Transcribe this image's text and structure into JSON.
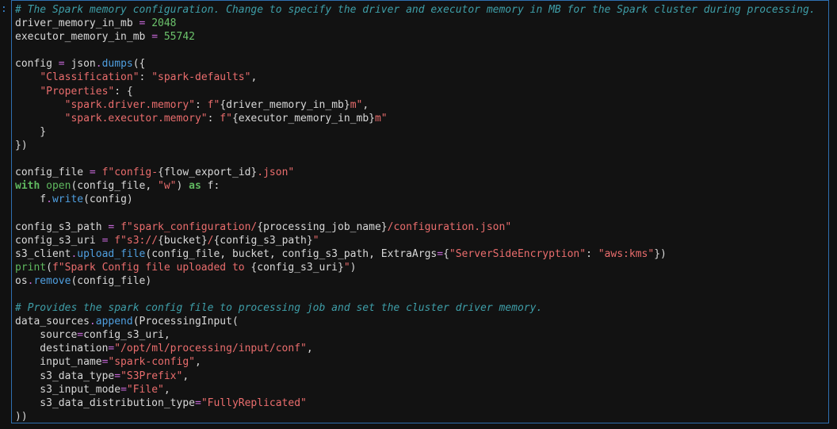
{
  "gutter": {
    "marker": ":"
  },
  "colors": {
    "background": "#121212",
    "cell_border": "#2f6fb0",
    "comment": "#3e9ea8",
    "string": "#ea6d6d",
    "number": "#6cc36c",
    "operator": "#c768d8",
    "keyword": "#5fb85f",
    "function": "#4f9fe0",
    "default": "#d8d8d8"
  },
  "code_lines": [
    [
      [
        "comment",
        "# The Spark memory configuration. Change to specify the driver and executor memory in MB for the Spark cluster during processing."
      ]
    ],
    [
      [
        "id",
        "driver_memory_in_mb "
      ],
      [
        "op",
        "="
      ],
      [
        "p",
        " "
      ],
      [
        "num",
        "2048"
      ]
    ],
    [
      [
        "id",
        "executor_memory_in_mb "
      ],
      [
        "op",
        "="
      ],
      [
        "p",
        " "
      ],
      [
        "num",
        "55742"
      ]
    ],
    [],
    [
      [
        "id",
        "config "
      ],
      [
        "op",
        "="
      ],
      [
        "p",
        " json"
      ],
      [
        "op",
        "."
      ],
      [
        "fn",
        "dumps"
      ],
      [
        "p",
        "({"
      ]
    ],
    [
      [
        "p",
        "    "
      ],
      [
        "str",
        "\"Classification\""
      ],
      [
        "p",
        ": "
      ],
      [
        "str",
        "\"spark-defaults\""
      ],
      [
        "p",
        ","
      ]
    ],
    [
      [
        "p",
        "    "
      ],
      [
        "str",
        "\"Properties\""
      ],
      [
        "p",
        ": {"
      ]
    ],
    [
      [
        "p",
        "        "
      ],
      [
        "str",
        "\"spark.driver.memory\""
      ],
      [
        "p",
        ": "
      ],
      [
        "str",
        "f\""
      ],
      [
        "p",
        "{driver_memory_in_mb}"
      ],
      [
        "str",
        "m\""
      ],
      [
        "p",
        ","
      ]
    ],
    [
      [
        "p",
        "        "
      ],
      [
        "str",
        "\"spark.executor.memory\""
      ],
      [
        "p",
        ": "
      ],
      [
        "str",
        "f\""
      ],
      [
        "p",
        "{executor_memory_in_mb}"
      ],
      [
        "str",
        "m\""
      ]
    ],
    [
      [
        "p",
        "    }"
      ]
    ],
    [
      [
        "p",
        "})"
      ]
    ],
    [],
    [
      [
        "id",
        "config_file "
      ],
      [
        "op",
        "="
      ],
      [
        "p",
        " "
      ],
      [
        "str",
        "f\"config-"
      ],
      [
        "p",
        "{flow_export_id}"
      ],
      [
        "str",
        ".json\""
      ]
    ],
    [
      [
        "kw",
        "with"
      ],
      [
        "p",
        " "
      ],
      [
        "bi",
        "open"
      ],
      [
        "p",
        "(config_file, "
      ],
      [
        "str",
        "\"w\""
      ],
      [
        "p",
        ") "
      ],
      [
        "kw",
        "as"
      ],
      [
        "p",
        " f:"
      ]
    ],
    [
      [
        "p",
        "    f"
      ],
      [
        "op",
        "."
      ],
      [
        "fn",
        "write"
      ],
      [
        "p",
        "(config)"
      ]
    ],
    [],
    [
      [
        "id",
        "config_s3_path "
      ],
      [
        "op",
        "="
      ],
      [
        "p",
        " "
      ],
      [
        "str",
        "f\"spark_configuration/"
      ],
      [
        "p",
        "{processing_job_name}"
      ],
      [
        "str",
        "/configuration.json\""
      ]
    ],
    [
      [
        "id",
        "config_s3_uri "
      ],
      [
        "op",
        "="
      ],
      [
        "p",
        " "
      ],
      [
        "str",
        "f\"s3://"
      ],
      [
        "p",
        "{bucket}"
      ],
      [
        "str",
        "/"
      ],
      [
        "p",
        "{config_s3_path}"
      ],
      [
        "str",
        "\""
      ]
    ],
    [
      [
        "id",
        "s3_client"
      ],
      [
        "op",
        "."
      ],
      [
        "fn",
        "upload_file"
      ],
      [
        "p",
        "(config_file, bucket, config_s3_path, ExtraArgs"
      ],
      [
        "op",
        "="
      ],
      [
        "p",
        "{"
      ],
      [
        "str",
        "\"ServerSideEncryption\""
      ],
      [
        "p",
        ": "
      ],
      [
        "str",
        "\"aws:kms\""
      ],
      [
        "p",
        "})"
      ]
    ],
    [
      [
        "bi",
        "print"
      ],
      [
        "p",
        "("
      ],
      [
        "str",
        "f\"Spark Config file uploaded to "
      ],
      [
        "p",
        "{config_s3_uri}"
      ],
      [
        "str",
        "\""
      ],
      [
        "p",
        ")"
      ]
    ],
    [
      [
        "id",
        "os"
      ],
      [
        "op",
        "."
      ],
      [
        "fn",
        "remove"
      ],
      [
        "p",
        "(config_file)"
      ]
    ],
    [],
    [
      [
        "comment",
        "# Provides the spark config file to processing job and set the cluster driver memory."
      ]
    ],
    [
      [
        "id",
        "data_sources"
      ],
      [
        "op",
        "."
      ],
      [
        "fn",
        "append"
      ],
      [
        "p",
        "(ProcessingInput("
      ]
    ],
    [
      [
        "p",
        "    source"
      ],
      [
        "op",
        "="
      ],
      [
        "p",
        "config_s3_uri,"
      ]
    ],
    [
      [
        "p",
        "    destination"
      ],
      [
        "op",
        "="
      ],
      [
        "str",
        "\"/opt/ml/processing/input/conf\""
      ],
      [
        "p",
        ","
      ]
    ],
    [
      [
        "p",
        "    input_name"
      ],
      [
        "op",
        "="
      ],
      [
        "str",
        "\"spark-config\""
      ],
      [
        "p",
        ","
      ]
    ],
    [
      [
        "p",
        "    s3_data_type"
      ],
      [
        "op",
        "="
      ],
      [
        "str",
        "\"S3Prefix\""
      ],
      [
        "p",
        ","
      ]
    ],
    [
      [
        "p",
        "    s3_input_mode"
      ],
      [
        "op",
        "="
      ],
      [
        "str",
        "\"File\""
      ],
      [
        "p",
        ","
      ]
    ],
    [
      [
        "p",
        "    s3_data_distribution_type"
      ],
      [
        "op",
        "="
      ],
      [
        "str",
        "\"FullyReplicated\""
      ]
    ],
    [
      [
        "p",
        "))"
      ]
    ]
  ]
}
